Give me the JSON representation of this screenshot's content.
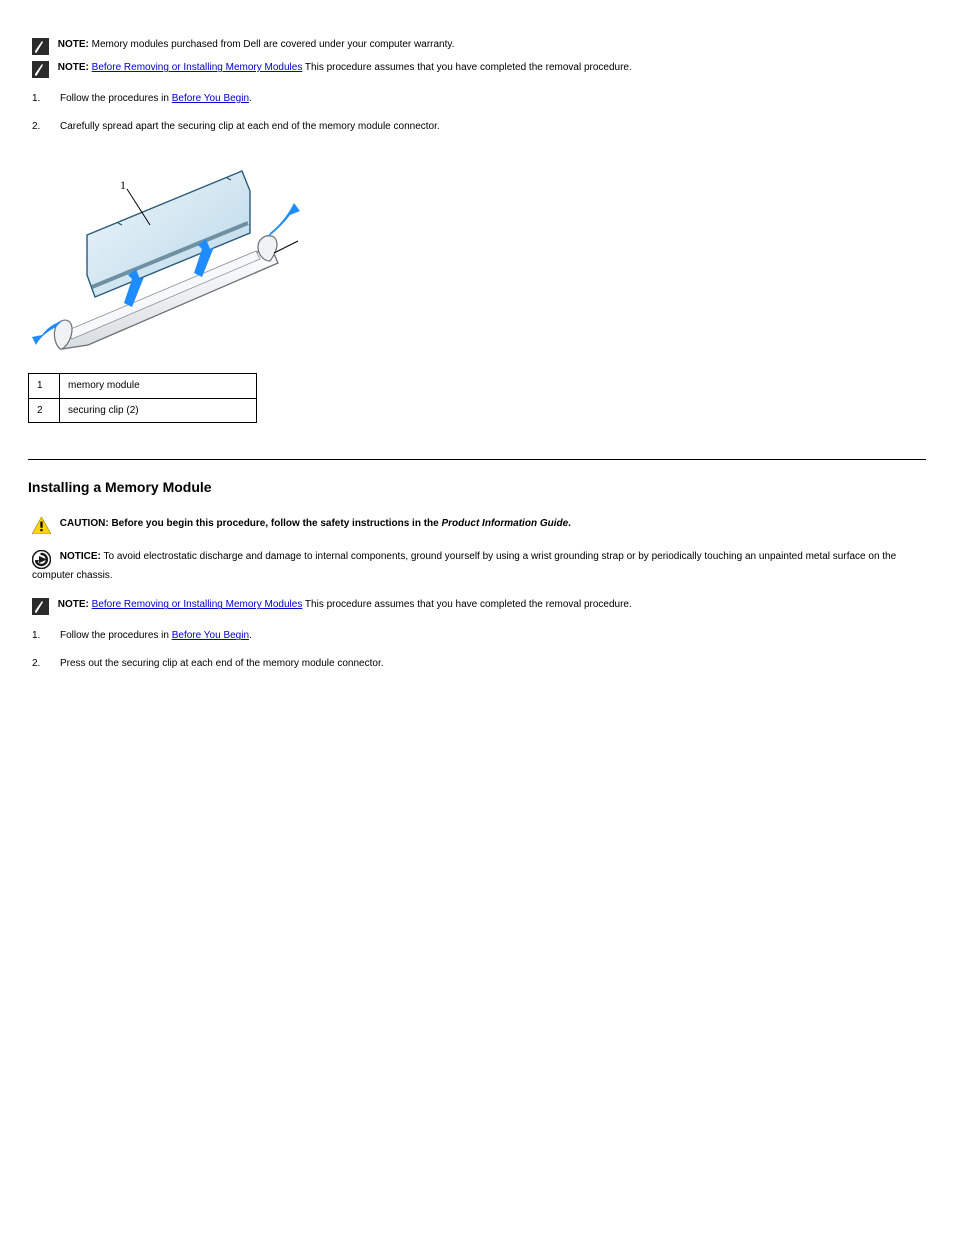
{
  "notes": {
    "note1": {
      "label": "NOTE:",
      "text": " Memory modules purchased from Dell are covered under your computer warranty."
    },
    "note2": {
      "label": "NOTE:",
      "text": " This procedure assumes that you have completed the removal procedure.",
      "link_text": "Before Removing or Installing Memory Modules"
    }
  },
  "steps_top": [
    {
      "num": "1.",
      "text": "Follow the procedures in ",
      "link": "Before You Begin",
      "tail": "."
    },
    {
      "num": "2.",
      "text": "Carefully spread apart the securing clip at each end of the memory module connector."
    }
  ],
  "legend": [
    {
      "num": "1",
      "label": "memory module"
    },
    {
      "num": "2",
      "label": "securing clip (2)"
    }
  ],
  "hr": "",
  "section2": {
    "title": "Installing a Memory Module",
    "caution": {
      "label": "CAUTION:",
      "text": " Before you begin this procedure, follow the safety instructions in the ",
      "italic": "Product Information Guide",
      "tail": "."
    },
    "notice": {
      "label": "NOTICE:",
      "text": " To avoid electrostatic discharge and damage to internal components, ground yourself by using a wrist grounding strap or by periodically touching an unpainted metal surface on the computer chassis."
    },
    "note": {
      "label": "NOTE:",
      "text": " This procedure assumes that you have completed the removal procedure.",
      "link_text": "Before Removing or Installing Memory Modules"
    },
    "steps": [
      {
        "num": "1.",
        "text": "Follow the procedures in ",
        "link": "Before You Begin",
        "tail": "."
      },
      {
        "num": "2.",
        "text": "Press out the securing clip at each end of the memory module connector."
      }
    ]
  },
  "chart_data": {
    "type": "diagram",
    "title": "Memory module removal illustration",
    "callouts": [
      {
        "id": 1,
        "label": "memory module"
      },
      {
        "id": 2,
        "label": "securing clip (2)"
      }
    ],
    "motion_arrows": 4
  }
}
